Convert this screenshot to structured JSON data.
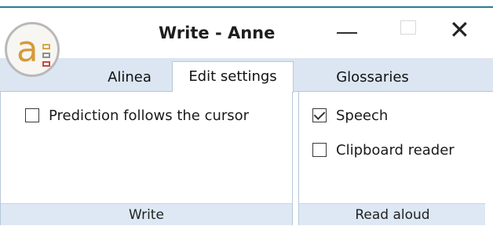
{
  "window": {
    "title": "Write - Anne"
  },
  "tabs": [
    {
      "label": "Alinea"
    },
    {
      "label": "Edit settings"
    },
    {
      "label": "Glossaries"
    }
  ],
  "groups": {
    "write": {
      "label": "Write",
      "options": [
        {
          "label": "Prediction follows the cursor",
          "checked": false
        }
      ]
    },
    "read_aloud": {
      "label": "Read aloud",
      "options": [
        {
          "label": "Speech",
          "checked": true
        },
        {
          "label": "Clipboard reader",
          "checked": false
        }
      ]
    }
  },
  "icons": {
    "logo": "app-logo-icon",
    "minimize": "minimize-icon",
    "maximize": "maximize-icon",
    "close": "close-icon"
  },
  "colors": {
    "accent_border": "#2b7a92",
    "tab_bar": "#dce6f2",
    "group_label_bg": "#dde8f4",
    "logo_orange": "#d79a39"
  }
}
